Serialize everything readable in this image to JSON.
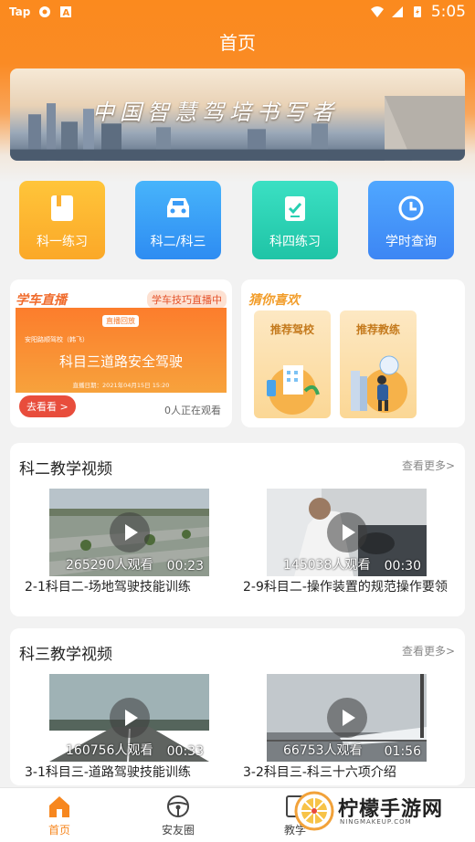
{
  "status_bar": {
    "carrier": "Tap",
    "time": "5:05"
  },
  "header": {
    "title": "首页"
  },
  "banner": {
    "slogan": "中国智慧驾培书写者"
  },
  "quick_menu": [
    {
      "label": "科一练习",
      "icon": "book-icon"
    },
    {
      "label": "科二/科三",
      "icon": "car-icon"
    },
    {
      "label": "科四练习",
      "icon": "checklist-icon"
    },
    {
      "label": "学时查询",
      "icon": "clock-icon"
    }
  ],
  "live": {
    "tag": "学车直播",
    "hot": "学车技巧直播中",
    "poster_badge": "直播回放",
    "poster_school": "安阳路顺驾校（韩飞）",
    "poster_title": "科目三道路安全驾驶",
    "poster_date": "直播日期：2021年04月15日 15:20",
    "go_button": "去看看 >",
    "watching": "0人正在观看"
  },
  "recommend": {
    "tag": "猜你喜欢",
    "items": [
      {
        "label": "推荐驾校"
      },
      {
        "label": "推荐教练"
      }
    ]
  },
  "sections": [
    {
      "title": "科二教学视频",
      "more": "查看更多>",
      "videos": [
        {
          "views": "265290人观看",
          "duration": "00:23",
          "title": "2-1科目二-场地驾驶技能训练"
        },
        {
          "views": "145038人观看",
          "duration": "00:30",
          "title": "2-9科目二-操作装置的规范操作要领"
        }
      ]
    },
    {
      "title": "科三教学视频",
      "more": "查看更多>",
      "videos": [
        {
          "views": "160756人观看",
          "duration": "00:33",
          "title": "3-1科目三-道路驾驶技能训练"
        },
        {
          "views": "66753人观看",
          "duration": "01:56",
          "title": "3-2科目三-科三十六项介绍"
        }
      ]
    }
  ],
  "bottom_nav": [
    {
      "label": "首页",
      "active": true
    },
    {
      "label": "安友圈"
    },
    {
      "label": "教学"
    }
  ],
  "watermark": {
    "text": "柠檬手游网",
    "sub": "NINGMAKEUP.COM"
  },
  "colors": {
    "accent": "#f7871f",
    "header": "#fb8a1e"
  }
}
